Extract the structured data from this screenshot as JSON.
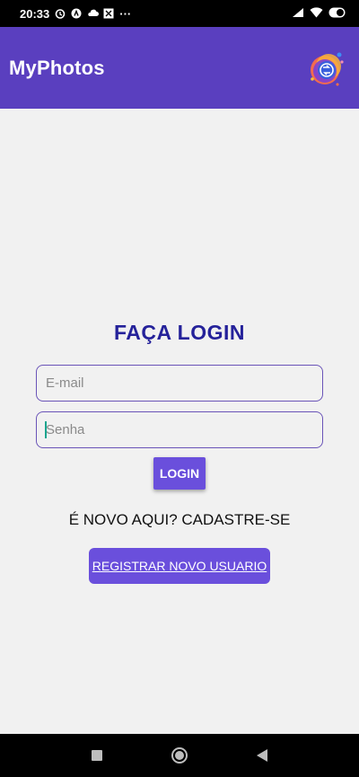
{
  "status_bar": {
    "time": "20:33",
    "more": "···",
    "icons": [
      "alarm-icon",
      "app-icon",
      "cloud-icon",
      "widget-icon",
      "signal-icon",
      "wifi-icon",
      "battery-icon"
    ]
  },
  "app_bar": {
    "title": "MyPhotos",
    "logo_icon": "app-logo-icon"
  },
  "login": {
    "title": "FAÇA LOGIN",
    "email_placeholder": "E-mail",
    "password_placeholder": "Senha",
    "login_button": "LOGIN",
    "signup_text": "É NOVO AQUI? CADASTRE-SE",
    "register_button": "REGISTRAR NOVO USUARIO"
  },
  "nav_bar": {
    "icons": [
      "recents-icon",
      "home-icon",
      "back-icon"
    ]
  },
  "colors": {
    "app_bar": "#5a3fbf",
    "title": "#25229a",
    "button": "#6a4fdc",
    "field_border": "#6a54b8",
    "background": "#f1f1f1"
  }
}
